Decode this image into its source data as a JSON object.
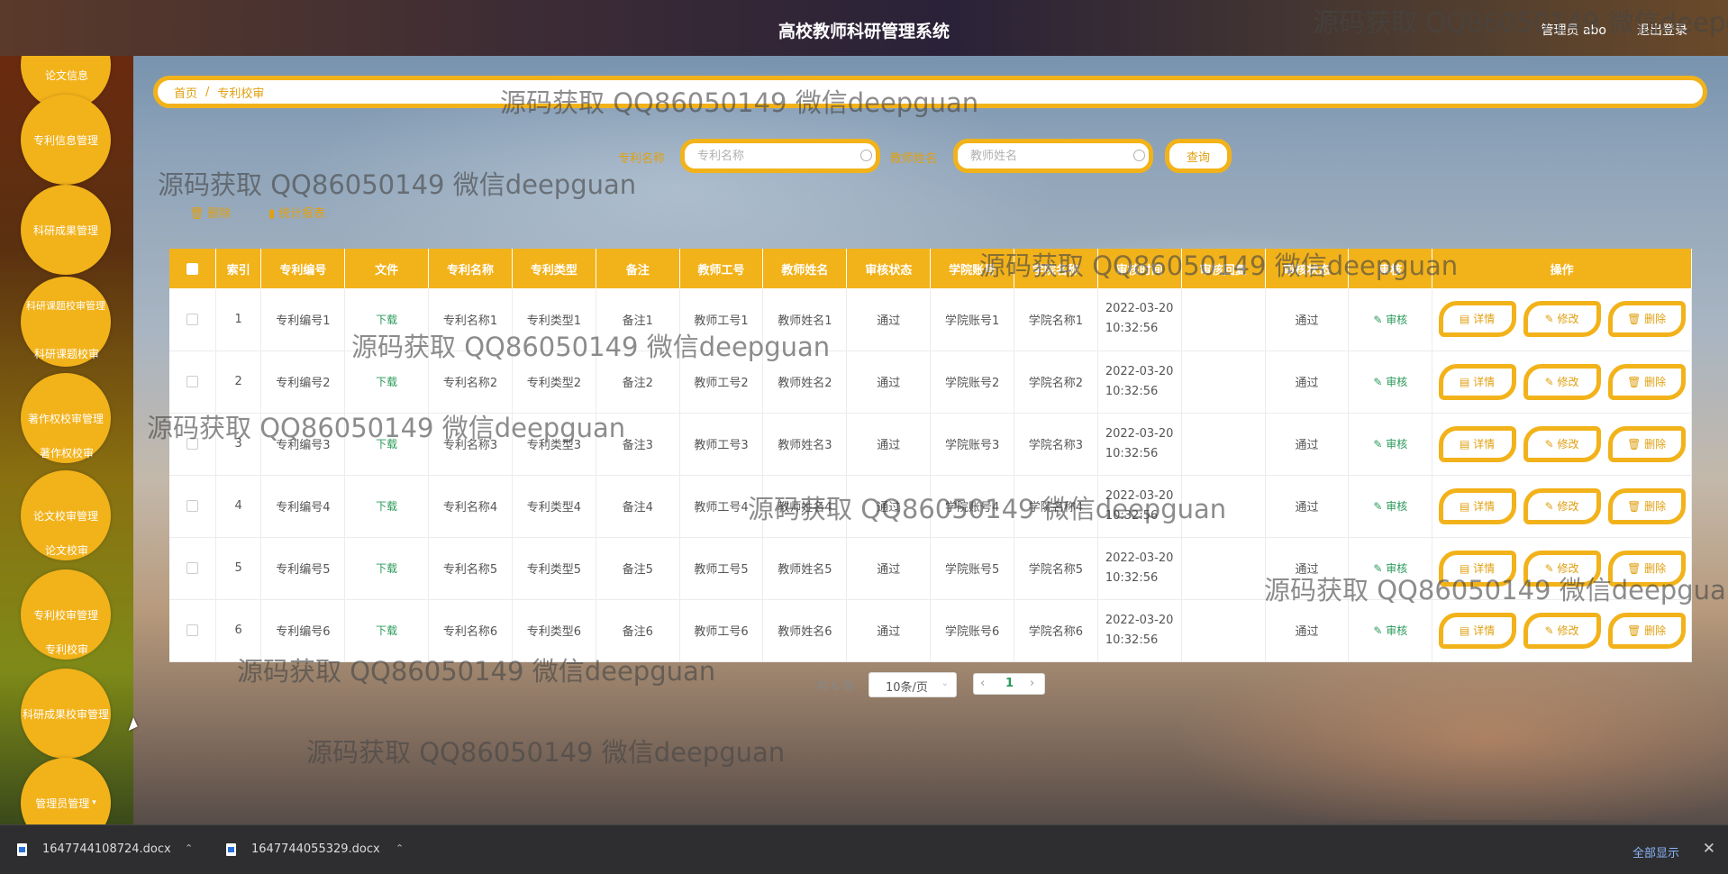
{
  "header": {
    "title": "高校教师科研管理系统",
    "user": "管理员 abo",
    "logout": "退出登录"
  },
  "sidebar": {
    "items": [
      {
        "label": "论文信息",
        "type": "sub"
      },
      {
        "label": "专利信息管理",
        "type": "circle"
      },
      {
        "label": "科研成果管理",
        "type": "circle"
      },
      {
        "label": "科研课题校审管理",
        "type": "circle"
      },
      {
        "label": "科研课题校审",
        "type": "sub"
      },
      {
        "label": "著作权校审管理",
        "type": "circle"
      },
      {
        "label": "著作权校审",
        "type": "sub"
      },
      {
        "label": "论文校审管理",
        "type": "circle"
      },
      {
        "label": "论文校审",
        "type": "sub"
      },
      {
        "label": "专利校审管理",
        "type": "circle"
      },
      {
        "label": "专利校审",
        "type": "sub"
      },
      {
        "label": "科研成果校审管理",
        "type": "circle"
      },
      {
        "label": "管理员管理",
        "type": "circle"
      }
    ]
  },
  "breadcrumb": {
    "home": "首页",
    "separator": "/",
    "current": "专利校审"
  },
  "search": {
    "patent_name_label": "专利名称",
    "patent_name_placeholder": "专利名称",
    "teacher_name_label": "教师姓名",
    "teacher_name_placeholder": "教师姓名",
    "query_button": "查询"
  },
  "actions": {
    "delete": "删除",
    "report": "统计报表"
  },
  "table": {
    "columns": [
      "",
      "索引",
      "专利编号",
      "文件",
      "专利名称",
      "专利类型",
      "备注",
      "教师工号",
      "教师姓名",
      "审核状态",
      "学院账号",
      "学院名称",
      "审核时间",
      "审核回复",
      "审核状态",
      "审核",
      "操作"
    ],
    "rows": [
      {
        "index": "1",
        "code": "专利编号1",
        "file": "下载",
        "name": "专利名称1",
        "type": "专利类型1",
        "note": "备注1",
        "teacher_id": "教师工号1",
        "teacher_name": "教师姓名1",
        "status": "通过",
        "college_account": "学院账号1",
        "college_name": "学院名称1",
        "time": "2022-03-20 10:32:56",
        "reply": "",
        "status2": "通过",
        "audit": "审核"
      },
      {
        "index": "2",
        "code": "专利编号2",
        "file": "下载",
        "name": "专利名称2",
        "type": "专利类型2",
        "note": "备注2",
        "teacher_id": "教师工号2",
        "teacher_name": "教师姓名2",
        "status": "通过",
        "college_account": "学院账号2",
        "college_name": "学院名称2",
        "time": "2022-03-20 10:32:56",
        "reply": "",
        "status2": "通过",
        "audit": "审核"
      },
      {
        "index": "3",
        "code": "专利编号3",
        "file": "下载",
        "name": "专利名称3",
        "type": "专利类型3",
        "note": "备注3",
        "teacher_id": "教师工号3",
        "teacher_name": "教师姓名3",
        "status": "通过",
        "college_account": "学院账号3",
        "college_name": "学院名称3",
        "time": "2022-03-20 10:32:56",
        "reply": "",
        "status2": "通过",
        "audit": "审核"
      },
      {
        "index": "4",
        "code": "专利编号4",
        "file": "下载",
        "name": "专利名称4",
        "type": "专利类型4",
        "note": "备注4",
        "teacher_id": "教师工号4",
        "teacher_name": "教师姓名4",
        "status": "通过",
        "college_account": "学院账号4",
        "college_name": "学院名称4",
        "time": "2022-03-20 10:32:56",
        "reply": "",
        "status2": "通过",
        "audit": "审核"
      },
      {
        "index": "5",
        "code": "专利编号5",
        "file": "下载",
        "name": "专利名称5",
        "type": "专利类型5",
        "note": "备注5",
        "teacher_id": "教师工号5",
        "teacher_name": "教师姓名5",
        "status": "通过",
        "college_account": "学院账号5",
        "college_name": "学院名称5",
        "time": "2022-03-20 10:32:56",
        "reply": "",
        "status2": "通过",
        "audit": "审核"
      },
      {
        "index": "6",
        "code": "专利编号6",
        "file": "下载",
        "name": "专利名称6",
        "type": "专利类型6",
        "note": "备注6",
        "teacher_id": "教师工号6",
        "teacher_name": "教师姓名6",
        "status": "通过",
        "college_account": "学院账号6",
        "college_name": "学院名称6",
        "time": "2022-03-20 10:32:56",
        "reply": "",
        "status2": "通过",
        "audit": "审核"
      }
    ],
    "op_labels": {
      "detail": "详情",
      "edit": "修改",
      "delete": "删除"
    }
  },
  "pagination": {
    "total": "共 6 条",
    "page_size": "10条/页",
    "current_page": "1"
  },
  "watermark": "源码获取 QQ86050149 微信deepguan",
  "download_bar": {
    "files": [
      "1647744108724.docx",
      "1647744055329.docx"
    ],
    "show_all": "全部显示"
  },
  "colors": {
    "accent": "#f2b21a",
    "link_green": "#2a9a5a"
  }
}
